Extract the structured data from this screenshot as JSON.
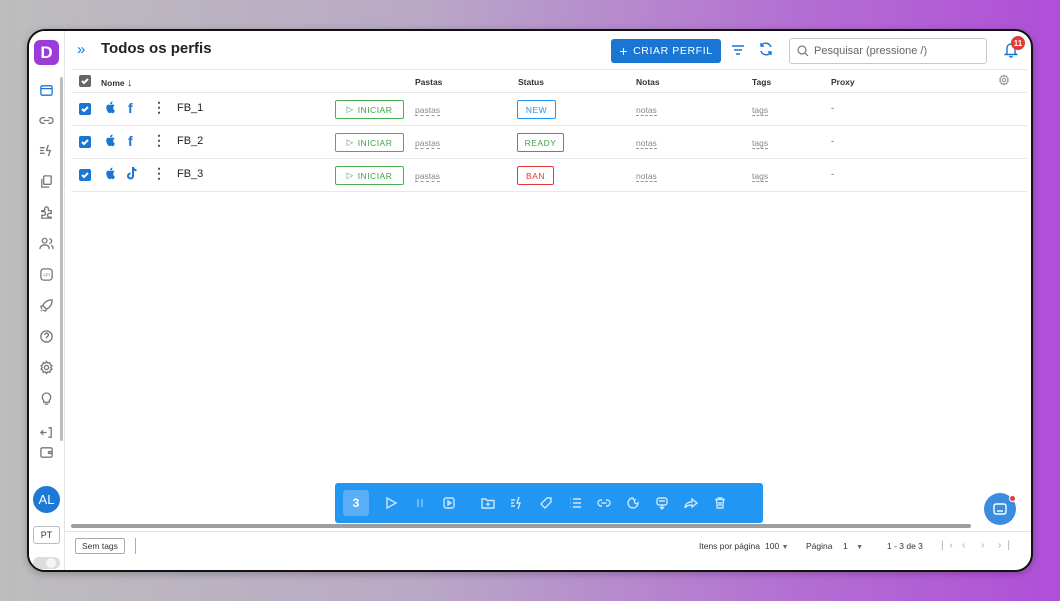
{
  "app": {
    "logo_letter": "D",
    "accent": "#1976d2",
    "brand": "#9b3cd8"
  },
  "header": {
    "title": "Todos os perfis",
    "create_label": "CRIAR PERFIL",
    "search_placeholder": "Pesquisar (pressione /)",
    "notifications": "11"
  },
  "sidebar": {
    "items": [
      "profiles-icon",
      "link-icon",
      "automation-icon",
      "copy-icon",
      "extensions-icon",
      "users-icon",
      "api-icon",
      "rocket-icon",
      "help-icon",
      "settings-icon",
      "idea-icon",
      "logout-icon",
      "wallet-icon"
    ],
    "avatar": "AL",
    "language": "PT"
  },
  "table": {
    "columns": {
      "name": "Nome",
      "folders": "Pastas",
      "status": "Status",
      "notes": "Notas",
      "tags": "Tags",
      "proxy": "Proxy"
    },
    "rows": [
      {
        "name": "FB_1",
        "platform": "facebook",
        "start": "INICIAR",
        "folders": "pastas",
        "status": "NEW",
        "status_color": "#2196f3",
        "notes": "notas",
        "tags": "tags",
        "proxy": "-"
      },
      {
        "name": "FB_2",
        "platform": "facebook",
        "start": "INICIAR",
        "folders": "pastas",
        "status": "READY",
        "status_color": "#43a047",
        "notes": "notas",
        "tags": "tags",
        "proxy": "-"
      },
      {
        "name": "FB_3",
        "platform": "tiktok",
        "start": "INICIAR",
        "folders": "pastas",
        "status": "BAN",
        "status_color": "#e53935",
        "notes": "notas",
        "tags": "tags",
        "proxy": "-"
      }
    ]
  },
  "toolbar": {
    "selected_count": "3"
  },
  "footer": {
    "tag_filter": "Sem tags",
    "items_per_page_label": "Itens por página",
    "items_per_page": "100",
    "page_label": "Página",
    "page": "1",
    "range": "1 - 3 de 3"
  }
}
